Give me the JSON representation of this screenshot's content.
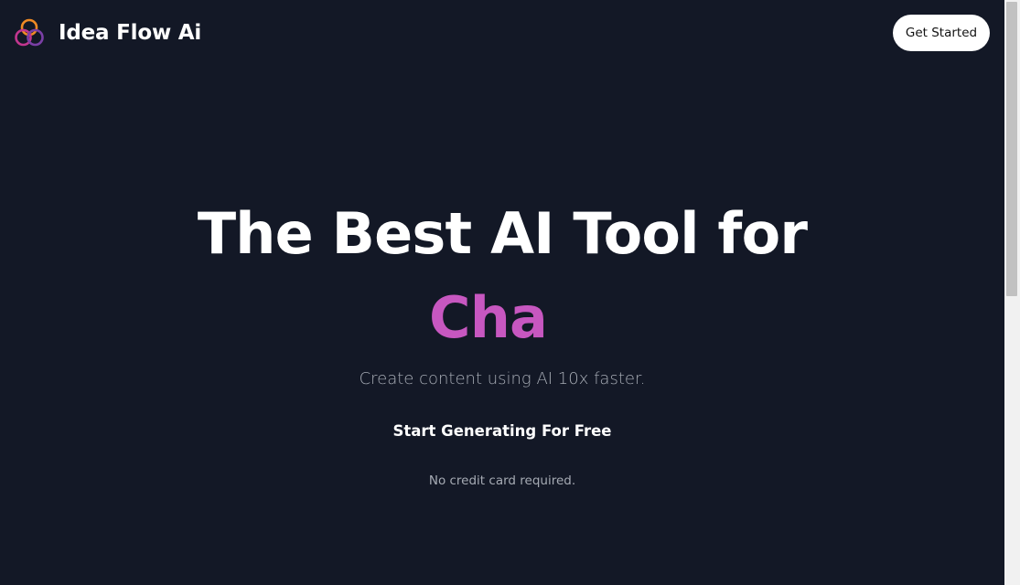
{
  "header": {
    "brand_name": "Idea Flow Ai",
    "logo_icon": "interlocking-rings-logo-icon",
    "get_started_label": "Get Started"
  },
  "hero": {
    "title": "The Best AI Tool for",
    "typed_text": "Cha",
    "subtitle": "Create content using AI 10x faster.",
    "cta_label": "Start Generating For Free",
    "note": "No credit card required."
  },
  "colors": {
    "background": "#131826",
    "accent": "#c757c0",
    "logo_orange": "#f08a24",
    "logo_magenta": "#c2368f",
    "logo_purple": "#7b3fa6",
    "subtle_text": "#a6abb4"
  }
}
